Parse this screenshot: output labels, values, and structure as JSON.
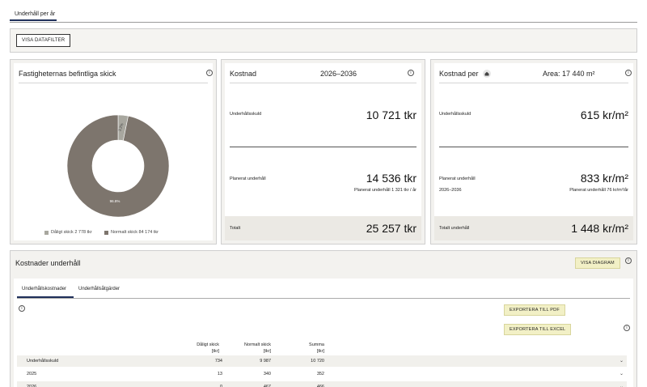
{
  "top_tab": {
    "label": "Underhåll per år"
  },
  "filter": {
    "button_label": "VISA DATAFILTER"
  },
  "card_condition": {
    "title": "Fastigheternas befintliga skick",
    "chart_data": {
      "type": "pie",
      "categories": [
        "Dåligt skick",
        "Normalt skick"
      ],
      "values": [
        2778,
        84174
      ],
      "percent_labels": [
        "3.2%",
        "96.8%"
      ],
      "colors": [
        "#a8a79f",
        "#7d756d"
      ]
    },
    "legend": [
      {
        "label": "Dåligt skick 2 778 tkr",
        "color": "#a8a79f"
      },
      {
        "label": "Normalt skick 84 174 tkr",
        "color": "#7d756d"
      }
    ]
  },
  "card_cost": {
    "title": "Kostnad",
    "period": "2026–2036",
    "debt_label": "Underhållsskuld",
    "debt_value": "10 721 tkr",
    "planned_label": "Planerat underhåll",
    "planned_value": "14 536 tkr",
    "planned_note": "Planerat underhåll 1 321 tkr / år",
    "total_label": "Totalt",
    "total_value": "25 257 tkr"
  },
  "card_cost_per": {
    "title": "Kostnad per",
    "area": "Area: 17 440 m²",
    "debt_label": "Underhållsskuld",
    "debt_value": "615 kr/m²",
    "planned_label": "Planerat underhåll",
    "planned_period": "2026–2036",
    "planned_value": "833 kr/m²",
    "planned_note": "Planerat underhåll 76 kr/m²/år",
    "total_label": "Totalt underhåll",
    "total_value": "1 448 kr/m²"
  },
  "panel": {
    "title": "Kostnader underhåll",
    "show_chart_label": "VISA DIAGRAM",
    "tabs": [
      "Underhållskostnader",
      "Underhållsåtgärder"
    ],
    "export_pdf_label": "EXPORTERA TILL PDF",
    "export_excel_label": "EXPORTERA TILL EXCEL",
    "columns": [
      {
        "line1": "Dåligt skick",
        "line2": "[tkr]"
      },
      {
        "line1": "Normalt skick",
        "line2": "[tkr]"
      },
      {
        "line1": "Summa",
        "line2": "[tkr]"
      }
    ],
    "rows": [
      {
        "label": "Underhållsskuld",
        "values": [
          "734",
          "9 987",
          "10 720"
        ]
      },
      {
        "label": "2025",
        "values": [
          "13",
          "340",
          "352"
        ]
      },
      {
        "label": "2026",
        "values": [
          "0",
          "467",
          "466"
        ]
      }
    ]
  }
}
